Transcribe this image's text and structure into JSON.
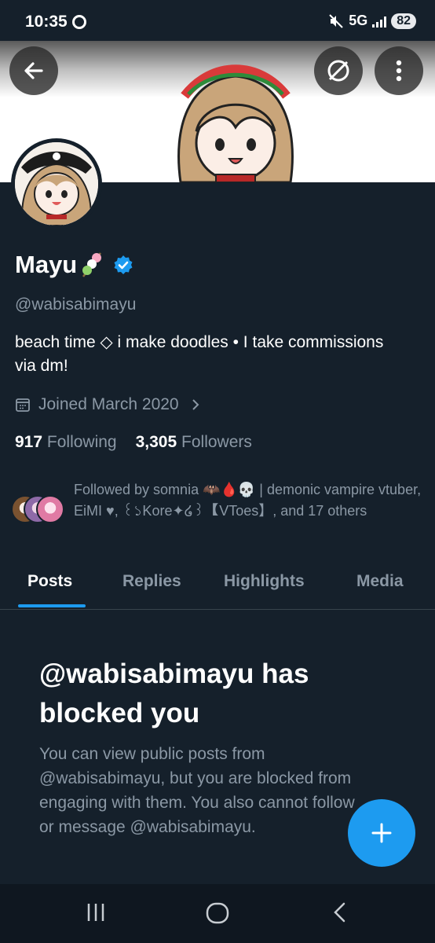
{
  "status_bar": {
    "time": "10:35",
    "network": "5G",
    "battery": "82"
  },
  "header": {
    "back_icon": "arrow-left-icon",
    "block_icon": "blocked-circle-icon",
    "more_icon": "more-vertical-icon"
  },
  "profile": {
    "display_name": "Mayu",
    "name_emoji": "dango-icon",
    "verified_icon": "verified-badge-icon",
    "handle": "@wabisabimayu",
    "bio": "beach time ◇ i make doodles • I take commissions via dm!",
    "joined": "Joined March 2020",
    "following_count": "917",
    "following_label": "Following",
    "followers_count": "3,305",
    "followers_label": "Followers",
    "followed_by": "Followed by somnia 🦇🩸💀 | demonic vampire vtuber, EiMI ♥, ꒰১Kore✦໒꒱ 【VToes】, and 17 others"
  },
  "tabs": [
    {
      "label": "Posts",
      "active": true
    },
    {
      "label": "Replies",
      "active": false
    },
    {
      "label": "Highlights",
      "active": false
    },
    {
      "label": "Media",
      "active": false
    }
  ],
  "blocked_notice": {
    "title": "@wabisabimayu has blocked you",
    "description": "You can view public posts from @wabisabimayu, but you are blocked from engaging with them. You also cannot follow or message @wabisabimayu."
  },
  "fab": {
    "icon": "plus-icon"
  },
  "nav_bar": {
    "recents_icon": "recents-icon",
    "home_icon": "home-icon",
    "back_icon": "back-chevron-icon"
  },
  "colors": {
    "background": "#15202b",
    "accent": "#1d9bf0",
    "secondary_text": "#8b98a5"
  }
}
